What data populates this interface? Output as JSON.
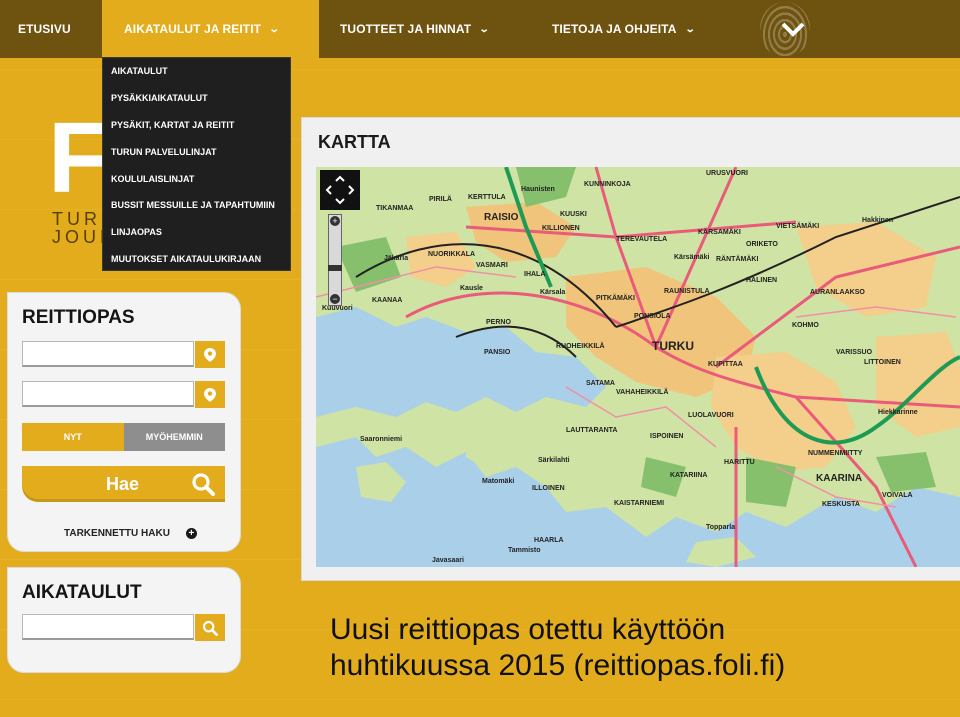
{
  "topnav": {
    "items": [
      {
        "label": "ETUSIVU"
      },
      {
        "label": "AIKATAULUT JA REITIT"
      },
      {
        "label": "TUOTTEET JA HINNAT"
      },
      {
        "label": "TIETOJA JA OHJEITA"
      }
    ]
  },
  "dropdown": {
    "items": [
      {
        "label": "AIKATAULUT"
      },
      {
        "label": "PYSÄKKIAIKATAULUT"
      },
      {
        "label": "PYSÄKIT, KARTAT JA REITIT"
      },
      {
        "label": "TURUN PALVELULINJAT"
      },
      {
        "label": "KOULULAISLINJAT"
      },
      {
        "label": "BUSSIT MESSUILLE JA TAPAHTUMIIN"
      },
      {
        "label": "LINJAOPAS"
      },
      {
        "label": "MUUTOKSET AIKATAULUKIRJAAN"
      }
    ]
  },
  "logo": {
    "mark": "Fö",
    "line1": "TURU",
    "line2": "JOUKK"
  },
  "reittiopas": {
    "title": "REITTIOPAS",
    "from_value": "",
    "to_value": "",
    "toggle_now": "NYT",
    "toggle_later": "MYÖHEMMIN",
    "search_label": "Hae",
    "advanced_label": "TARKENNETTU HAKU"
  },
  "aikataulut": {
    "title": "AIKATAULUT",
    "search_value": ""
  },
  "map": {
    "title": "KARTTA",
    "places": [
      {
        "name": "TURKU",
        "size": "big"
      },
      {
        "name": "KAARINA",
        "size": "mid"
      },
      {
        "name": "RAISIO",
        "size": "mid"
      },
      {
        "name": "KERTTULA"
      },
      {
        "name": "Haunisten"
      },
      {
        "name": "KUNNINKOJA"
      },
      {
        "name": "URUSVUORI"
      },
      {
        "name": "PIRILÄ"
      },
      {
        "name": "TIKANMAA"
      },
      {
        "name": "KUUSKI"
      },
      {
        "name": "KILLIONEN"
      },
      {
        "name": "TEREVAUTELA"
      },
      {
        "name": "KÄRSAMÄKI"
      },
      {
        "name": "VIETSÄMÄKI"
      },
      {
        "name": "Hakkinen"
      },
      {
        "name": "NUORIKKALA"
      },
      {
        "name": "VASMARI"
      },
      {
        "name": "Jäkärla"
      },
      {
        "name": "Kärsämäki"
      },
      {
        "name": "ORIKETO"
      },
      {
        "name": "RÄNTÄMÄKI"
      },
      {
        "name": "HALINEN"
      },
      {
        "name": "AURANLAAKSO"
      },
      {
        "name": "IHALA"
      },
      {
        "name": "Kärsala"
      },
      {
        "name": "Kausle"
      },
      {
        "name": "PITKÄMÄKI"
      },
      {
        "name": "RAUNISTULA"
      },
      {
        "name": "KAANAA"
      },
      {
        "name": "Kuuvuori"
      },
      {
        "name": "PERNO"
      },
      {
        "name": "PONSIOLA"
      },
      {
        "name": "KOHMO"
      },
      {
        "name": "PANSIO"
      },
      {
        "name": "RUOHEIKKILÄ"
      },
      {
        "name": "KUPITTAA"
      },
      {
        "name": "VARISSUO"
      },
      {
        "name": "LITTOINEN"
      },
      {
        "name": "SATAMA"
      },
      {
        "name": "VAHAHEIKKILÄ"
      },
      {
        "name": "LUOLAVUORI"
      },
      {
        "name": "Hiekkarinne"
      },
      {
        "name": "Saaronniemi"
      },
      {
        "name": "LAUTTARANTA"
      },
      {
        "name": "ISPOINEN"
      },
      {
        "name": "NUMMENMIITTY"
      },
      {
        "name": "Särkilahti"
      },
      {
        "name": "HARITTU"
      },
      {
        "name": "ILLOINEN"
      },
      {
        "name": "KATARIINA"
      },
      {
        "name": "KESKUSTA"
      },
      {
        "name": "VOIVALA"
      },
      {
        "name": "KAISTARNIEMI"
      },
      {
        "name": "Topparla"
      },
      {
        "name": "HAARLA"
      },
      {
        "name": "Tammisto"
      },
      {
        "name": "Javasaari"
      },
      {
        "name": "Matomäki"
      }
    ]
  },
  "caption": {
    "line1": "Uusi reittiopas otettu käyttöön",
    "line2": "huhtikuussa 2015 (reittiopas.foli.fi)"
  },
  "colors": {
    "brand_yellow": "#e2ac1c",
    "nav_dark": "#6e5210",
    "dropdown_bg": "#1f1f1f"
  },
  "icons": [
    "chevron-down-icon",
    "fingerprint-icon",
    "location-pin-icon",
    "search-icon",
    "plus-circle-icon",
    "pan-arrows-icon",
    "zoom-in-icon",
    "zoom-out-icon"
  ]
}
